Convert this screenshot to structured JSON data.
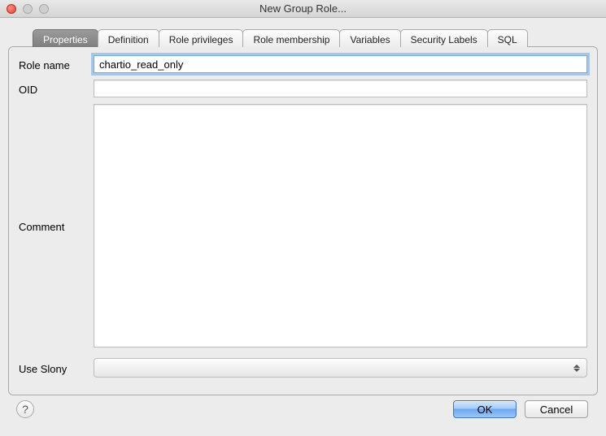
{
  "window": {
    "title": "New Group Role..."
  },
  "tabs": [
    {
      "label": "Properties"
    },
    {
      "label": "Definition"
    },
    {
      "label": "Role privileges"
    },
    {
      "label": "Role membership"
    },
    {
      "label": "Variables"
    },
    {
      "label": "Security Labels"
    },
    {
      "label": "SQL"
    }
  ],
  "form": {
    "role_name_label": "Role name",
    "role_name_value": "chartio_read_only",
    "oid_label": "OID",
    "oid_value": "",
    "comment_label": "Comment",
    "comment_value": "",
    "use_slony_label": "Use Slony",
    "use_slony_value": ""
  },
  "buttons": {
    "ok": "OK",
    "cancel": "Cancel",
    "help": "?"
  }
}
